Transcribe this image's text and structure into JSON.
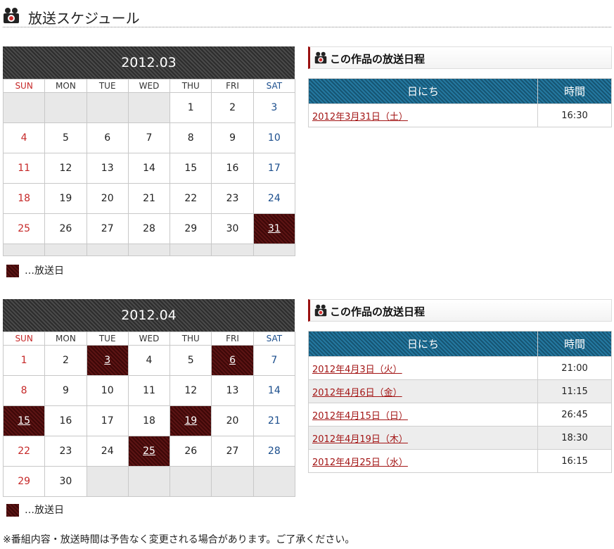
{
  "header": {
    "title": "放送スケジュール"
  },
  "legend_label": "…放送日",
  "calendars": [
    {
      "title": "2012.03",
      "weekdays": [
        "SUN",
        "MON",
        "TUE",
        "WED",
        "THU",
        "FRI",
        "SAT"
      ],
      "weeks": [
        [
          "",
          "",
          "",
          "",
          "1",
          "2",
          "3"
        ],
        [
          "4",
          "5",
          "6",
          "7",
          "8",
          "9",
          "10"
        ],
        [
          "11",
          "12",
          "13",
          "14",
          "15",
          "16",
          "17"
        ],
        [
          "18",
          "19",
          "20",
          "21",
          "22",
          "23",
          "24"
        ],
        [
          "25",
          "26",
          "27",
          "28",
          "29",
          "30",
          "31"
        ]
      ],
      "broadcast_days": [
        "31"
      ],
      "schedule": {
        "heading": "この作品の放送日程",
        "col_date": "日にち",
        "col_time": "時間",
        "rows": [
          {
            "date": "2012年3月31日（土）",
            "time": "16:30"
          }
        ]
      }
    },
    {
      "title": "2012.04",
      "weekdays": [
        "SUN",
        "MON",
        "TUE",
        "WED",
        "THU",
        "FRI",
        "SAT"
      ],
      "weeks": [
        [
          "1",
          "2",
          "3",
          "4",
          "5",
          "6",
          "7"
        ],
        [
          "8",
          "9",
          "10",
          "11",
          "12",
          "13",
          "14"
        ],
        [
          "15",
          "16",
          "17",
          "18",
          "19",
          "20",
          "21"
        ],
        [
          "22",
          "23",
          "24",
          "25",
          "26",
          "27",
          "28"
        ],
        [
          "29",
          "30",
          "",
          "",
          "",
          "",
          ""
        ]
      ],
      "broadcast_days": [
        "3",
        "6",
        "15",
        "19",
        "25"
      ],
      "schedule": {
        "heading": "この作品の放送日程",
        "col_date": "日にち",
        "col_time": "時間",
        "rows": [
          {
            "date": "2012年4月3日（火）",
            "time": "21:00"
          },
          {
            "date": "2012年4月6日（金）",
            "time": "11:15"
          },
          {
            "date": "2012年4月15日（日）",
            "time": "26:45"
          },
          {
            "date": "2012年4月19日（木）",
            "time": "18:30"
          },
          {
            "date": "2012年4月25日（水）",
            "time": "16:15"
          }
        ]
      }
    }
  ],
  "note": "※番組内容・放送時間は予告なく変更される場合があります。ご了承ください。",
  "colors": {
    "broadcast_day": "#4a0d0d",
    "header_bar": "#3b3b3b",
    "schedule_header": "#1c6486",
    "sunday": "#c62828",
    "saturday": "#1a4d8c",
    "link": "#a31515"
  },
  "icons": {
    "header": "camera-icon",
    "schedule": "camera-icon"
  }
}
